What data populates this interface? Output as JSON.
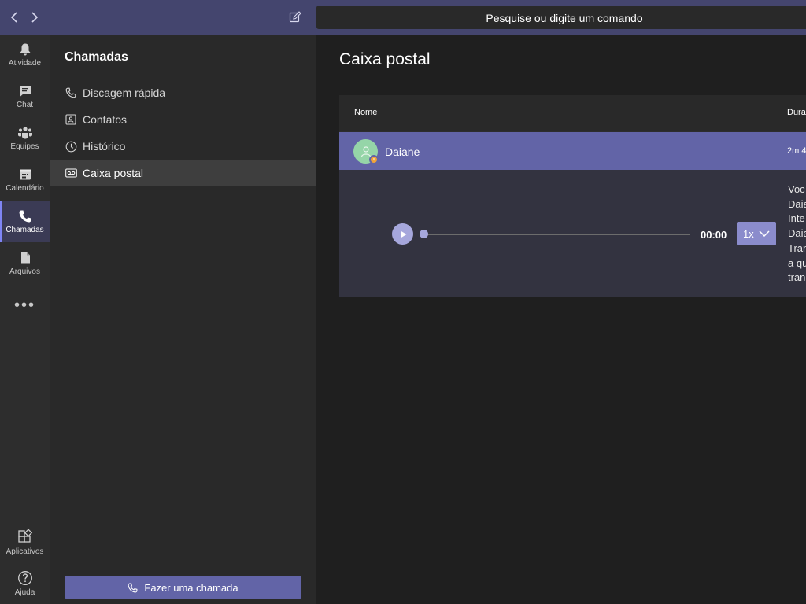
{
  "titlebar": {
    "search_placeholder": "Pesquise ou digite um comando"
  },
  "rail": {
    "items": [
      {
        "label": "Atividade",
        "icon": "bell-icon"
      },
      {
        "label": "Chat",
        "icon": "chat-icon"
      },
      {
        "label": "Equipes",
        "icon": "teams-icon"
      },
      {
        "label": "Calendário",
        "icon": "calendar-icon"
      },
      {
        "label": "Chamadas",
        "icon": "phone-icon",
        "active": true
      },
      {
        "label": "Arquivos",
        "icon": "file-icon"
      }
    ],
    "more": "•••",
    "bottom": [
      {
        "label": "Aplicativos",
        "icon": "apps-icon"
      },
      {
        "label": "Ajuda",
        "icon": "help-icon"
      }
    ]
  },
  "panel": {
    "title": "Chamadas",
    "items": [
      {
        "label": "Discagem rápida",
        "icon": "phone-icon"
      },
      {
        "label": "Contatos",
        "icon": "contact-card-icon"
      },
      {
        "label": "Histórico",
        "icon": "clock-icon"
      },
      {
        "label": "Caixa postal",
        "icon": "voicemail-icon",
        "active": true
      }
    ],
    "call_button": "Fazer uma chamada"
  },
  "main": {
    "title": "Caixa postal",
    "columns": [
      "Nome",
      "Dura"
    ],
    "rows": [
      {
        "name": "Daiane",
        "duration": "2m 4"
      }
    ],
    "player": {
      "time": "00:00",
      "speed": "1x",
      "progress": 0
    },
    "transcript": [
      "Voc",
      "Daia",
      "Inte",
      "Daia",
      "Tran",
      "a qu",
      "tran"
    ]
  },
  "colors": {
    "accent": "#6264a7",
    "titlebar": "#44456e",
    "presence_away": "#f0a33a",
    "avatar": "#95d5a8"
  }
}
